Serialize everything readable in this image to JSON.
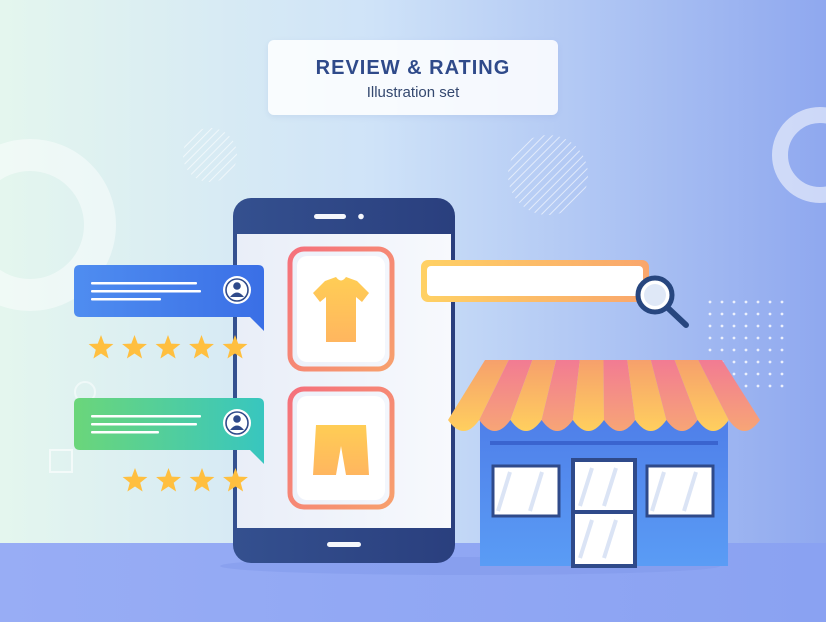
{
  "header": {
    "title": "REVIEW & RATING",
    "subtitle": "Illustration set"
  },
  "reviews": [
    {
      "stars": 5,
      "color_start": "#3d7ef0",
      "color_end": "#6cc3f5"
    },
    {
      "stars": 4,
      "color_start": "#5cd37a",
      "color_end": "#3bc7c6"
    }
  ],
  "colors": {
    "phone_body": "#2f4a8a",
    "product_frame": "#f07a7a",
    "product_fill": "#ffc25c",
    "star": "#ffbf3f",
    "store_wall": "#4a80ea",
    "awning_light": "#ffc861",
    "awning_dark": "#f0869a",
    "search_border": "#ffcf63",
    "magnifier": "#27467f"
  },
  "icons": [
    "tshirt-icon",
    "shorts-icon",
    "user-avatar-icon",
    "star-icon",
    "magnifier-icon",
    "storefront"
  ]
}
